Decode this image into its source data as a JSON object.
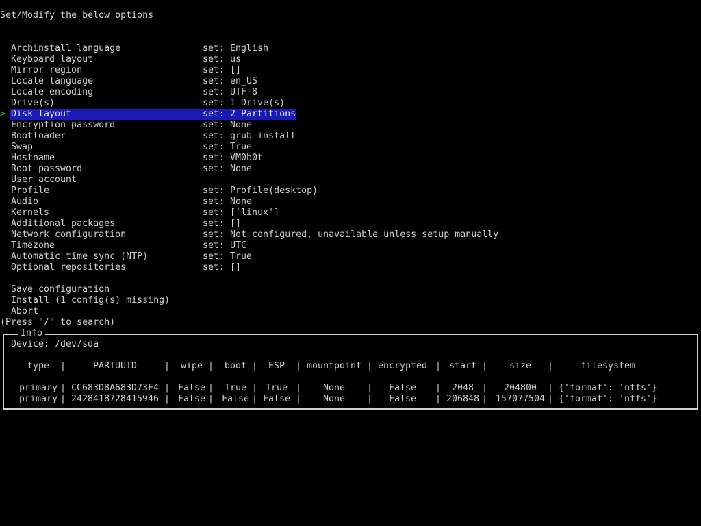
{
  "header": "Set/Modify the below options",
  "cursor_glyph": ">",
  "menu": [
    {
      "label": "Archinstall language",
      "value": "set: English"
    },
    {
      "label": "Keyboard layout",
      "value": "set: us"
    },
    {
      "label": "Mirror region",
      "value": "set: []"
    },
    {
      "label": "Locale language",
      "value": "set: en_US"
    },
    {
      "label": "Locale encoding",
      "value": "set: UTF-8"
    },
    {
      "label": "Drive(s)",
      "value": "set: 1 Drive(s)"
    },
    {
      "label": "Disk layout",
      "value": "set: 2 Partitions",
      "selected": true
    },
    {
      "label": "Encryption password",
      "value": "set: None"
    },
    {
      "label": "Bootloader",
      "value": "set: grub-install"
    },
    {
      "label": "Swap",
      "value": "set: True"
    },
    {
      "label": "Hostname",
      "value": "set: VM0b0t"
    },
    {
      "label": "Root password",
      "value": "set: None"
    },
    {
      "label": "User account",
      "value": ""
    },
    {
      "label": "Profile",
      "value": "set: Profile(desktop)"
    },
    {
      "label": "Audio",
      "value": "set: None"
    },
    {
      "label": "Kernels",
      "value": "set: ['linux']"
    },
    {
      "label": "Additional packages",
      "value": "set: []"
    },
    {
      "label": "Network configuration",
      "value": "set: Not configured, unavailable unless setup manually"
    },
    {
      "label": "Timezone",
      "value": "set: UTC"
    },
    {
      "label": "Automatic time sync (NTP)",
      "value": "set: True"
    },
    {
      "label": "Optional repositories",
      "value": "set: []"
    }
  ],
  "actions": [
    {
      "label": "Save configuration"
    },
    {
      "label": "Install (1 config(s) missing)"
    },
    {
      "label": "Abort"
    }
  ],
  "search_hint": "(Press \"/\" to search)",
  "info": {
    "title": "Info",
    "device": "Device: /dev/sda",
    "columns": [
      "type",
      "PARTUUID",
      "wipe",
      "boot",
      "ESP",
      "mountpoint",
      "encrypted",
      "start",
      "size",
      "filesystem"
    ],
    "rows": [
      [
        "primary",
        "CC683D8A683D73F4",
        "False",
        "True",
        "True",
        "None",
        "False",
        "2048",
        "204800",
        "{'format': 'ntfs'}"
      ],
      [
        "primary",
        "2428418728415946",
        "False",
        "False",
        "False",
        "None",
        "False",
        "206848",
        "157077504",
        "{'format': 'ntfs'}"
      ]
    ]
  },
  "colors": {
    "background": "#000000",
    "text": "#cfcfcf",
    "selection": "#1a1ab4",
    "cursor": "#2fd32f"
  }
}
